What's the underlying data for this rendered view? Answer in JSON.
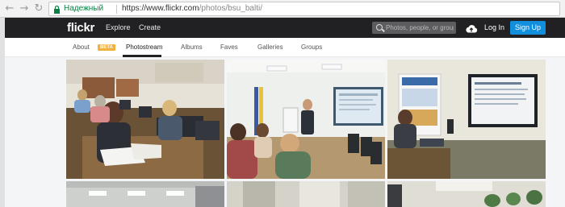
{
  "browser": {
    "back_icon": "arrow-left-icon",
    "forward_icon": "arrow-right-icon",
    "reload_icon": "reload-icon",
    "secure_label": "Надежный",
    "url_host": "https://www.flickr.com",
    "url_path": "/photos/bsu_balti/"
  },
  "header": {
    "logo": "flickr",
    "nav": [
      "Explore",
      "Create"
    ],
    "search_placeholder": "Photos, people, or groups",
    "upload_icon": "cloud-upload-icon",
    "login": "Log In",
    "signup": "Sign Up"
  },
  "subnav": {
    "items": [
      "About",
      "Photostream",
      "Albums",
      "Faves",
      "Galleries",
      "Groups"
    ],
    "beta": "BETA",
    "active": "Photostream"
  },
  "colors": {
    "topbar": "#212124",
    "signup": "#128fdc",
    "beta": "#f2b13c",
    "secure": "#0b8043"
  }
}
